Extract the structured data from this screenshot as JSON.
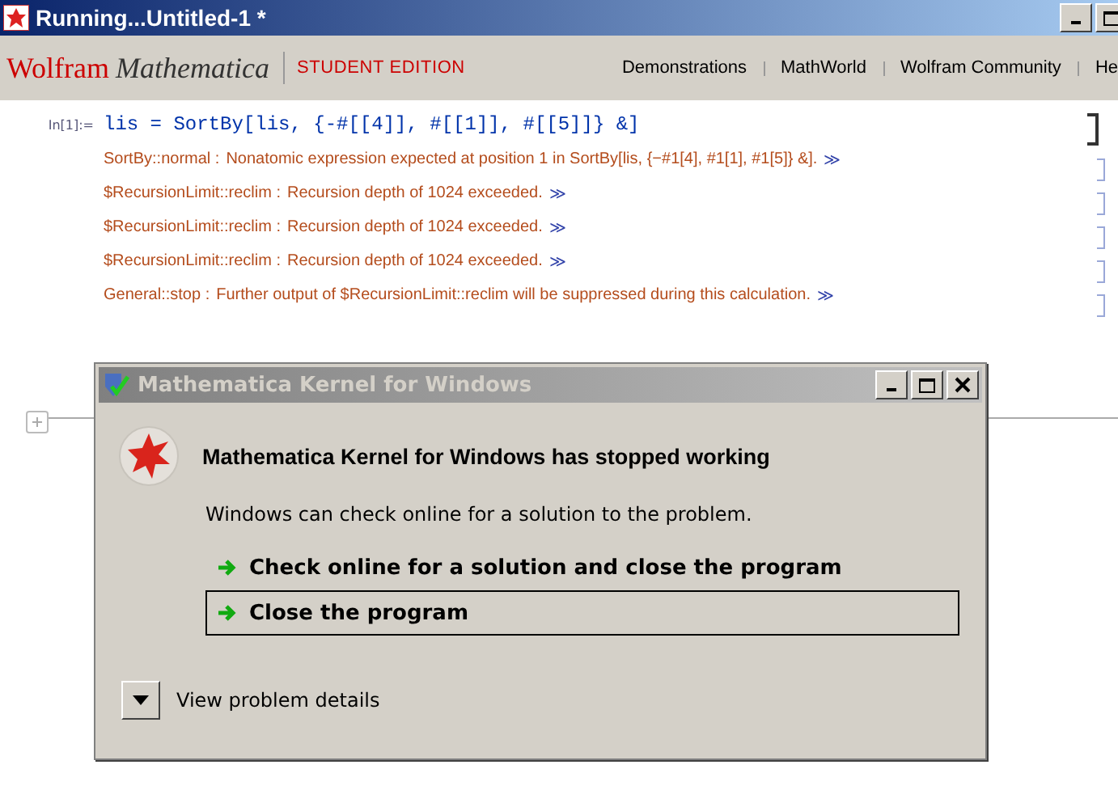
{
  "window": {
    "title": "Running...Untitled-1 *"
  },
  "header": {
    "brand": "Wolfram",
    "product": "Mathematica",
    "edition": "STUDENT EDITION",
    "links": [
      "Demonstrations",
      "MathWorld",
      "Wolfram Community",
      "He"
    ]
  },
  "notebook": {
    "input_label": "In[1]:=",
    "input_code": "lis = SortBy[lis, {-#[[4]], #[[1]], #[[5]]} &]",
    "messages": [
      {
        "tag": "SortBy::normal :",
        "text": "Nonatomic expression expected at position 1 in SortBy[lis, {−#1[4], #1[1], #1[5]} &].",
        "link": "≫"
      },
      {
        "tag": "$RecursionLimit::reclim :",
        "text": "Recursion depth of 1024 exceeded.",
        "link": "≫"
      },
      {
        "tag": "$RecursionLimit::reclim :",
        "text": "Recursion depth of 1024 exceeded.",
        "link": "≫"
      },
      {
        "tag": "$RecursionLimit::reclim :",
        "text": "Recursion depth of 1024 exceeded.",
        "link": "≫"
      },
      {
        "tag": "General::stop :",
        "text": "Further output of $RecursionLimit::reclim will be suppressed during this calculation.",
        "link": "≫"
      }
    ]
  },
  "dialog": {
    "title": "Mathematica Kernel for Windows",
    "heading": "Mathematica Kernel for Windows has stopped working",
    "body": "Windows can check online for a solution to the problem.",
    "options": [
      {
        "label": "Check online for a solution and close the program",
        "selected": false
      },
      {
        "label": "Close the program",
        "selected": true
      }
    ],
    "details": "View problem details"
  }
}
